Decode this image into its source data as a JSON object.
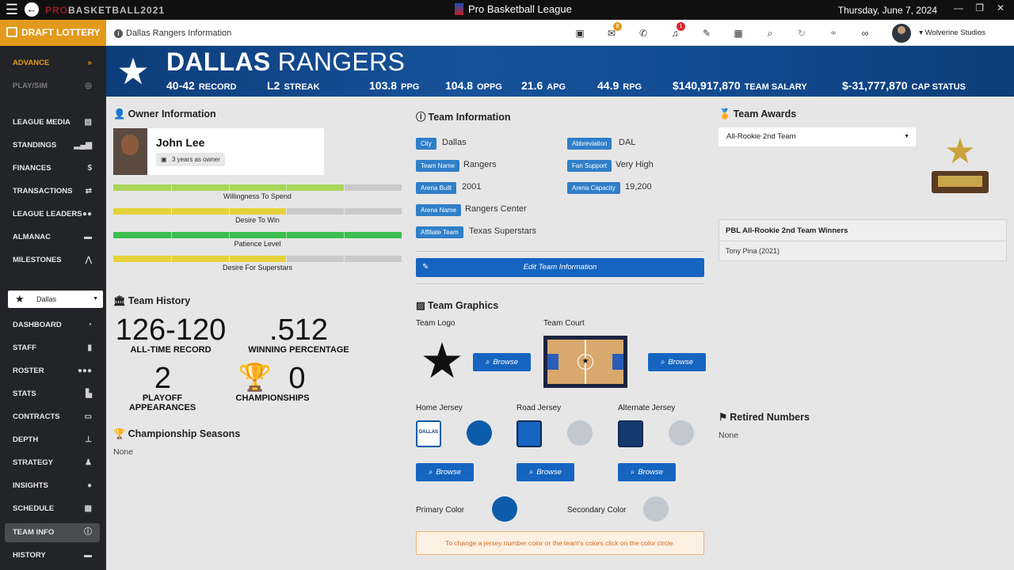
{
  "titlebar": {
    "brand_prefix": "PRO",
    "brand_suffix": "BASKETBALL2021",
    "league": "Pro Basketball League",
    "date": "Thursday, June 7, 2024"
  },
  "sidebar": {
    "draft_lottery": "DRAFT LOTTERY",
    "top_items": [
      {
        "label": "ADVANCE",
        "icon": "fast-forward-icon"
      },
      {
        "label": "PLAY/SIM",
        "icon": "basketball-icon"
      }
    ],
    "league_items": [
      {
        "label": "LEAGUE MEDIA",
        "icon": "newspaper-icon"
      },
      {
        "label": "STANDINGS",
        "icon": "bar-chart-icon"
      },
      {
        "label": "FINANCES",
        "icon": "dollar-icon"
      },
      {
        "label": "TRANSACTIONS",
        "icon": "exchange-icon"
      },
      {
        "label": "LEAGUE LEADERS",
        "icon": "users-icon"
      },
      {
        "label": "ALMANAC",
        "icon": "archive-icon"
      },
      {
        "label": "MILESTONES",
        "icon": "road-icon"
      }
    ],
    "team_select": "Dallas",
    "team_items": [
      {
        "label": "DASHBOARD",
        "icon": "gauge-icon"
      },
      {
        "label": "STAFF",
        "icon": "clipboard-icon"
      },
      {
        "label": "ROSTER",
        "icon": "people-icon"
      },
      {
        "label": "STATS",
        "icon": "chart-icon"
      },
      {
        "label": "CONTRACTS",
        "icon": "money-icon"
      },
      {
        "label": "DEPTH",
        "icon": "sitemap-icon"
      },
      {
        "label": "STRATEGY",
        "icon": "strategy-icon"
      },
      {
        "label": "INSIGHTS",
        "icon": "lightbulb-icon"
      },
      {
        "label": "SCHEDULE",
        "icon": "calendar-icon"
      },
      {
        "label": "TEAM INFO",
        "icon": "info-icon"
      },
      {
        "label": "HISTORY",
        "icon": "archive-icon"
      }
    ]
  },
  "header": {
    "page_title": "Dallas Rangers Information",
    "mail_badge": "8",
    "alert_badge": "1",
    "user": "Wolverine Studios"
  },
  "banner": {
    "team_city": "DALLAS",
    "team_name": "RANGERS",
    "record_value": "40-42",
    "record_label": "RECORD",
    "streak_value": "L2",
    "streak_label": "STREAK",
    "ppg_value": "103.8",
    "ppg_label": "PPG",
    "oppg_value": "104.8",
    "oppg_label": "OPPG",
    "apg_value": "21.6",
    "apg_label": "APG",
    "rpg_value": "44.9",
    "rpg_label": "RPG",
    "salary_value": "$140,917,870",
    "salary_label": "TEAM SALARY",
    "cap_value": "$-31,777,870",
    "cap_label": "CAP STATUS"
  },
  "owner": {
    "heading": "Owner Information",
    "name": "John Lee",
    "years": "3 years as owner",
    "bars": [
      {
        "label": "Willingness To Spend",
        "level": 0.8,
        "color": "#a8d65a"
      },
      {
        "label": "Desire To Win",
        "level": 0.6,
        "color": "#e6d23a"
      },
      {
        "label": "Patience Level",
        "level": 1.0,
        "color": "#3bbf4f"
      },
      {
        "label": "Desire For Superstars",
        "level": 0.6,
        "color": "#e6d23a"
      }
    ]
  },
  "history": {
    "heading": "Team History",
    "alltime_value": "126-120",
    "alltime_label": "ALL-TIME RECORD",
    "winpct_value": ".512",
    "winpct_label": "WINNING PERCENTAGE",
    "playoff_value": "2",
    "playoff_label": "PLAYOFF APPEARANCES",
    "champ_value": "0",
    "champ_label": "CHAMPIONSHIPS",
    "seasons_heading": "Championship Seasons",
    "seasons_value": "None"
  },
  "team_info": {
    "heading": "Team Information",
    "city_k": "City",
    "city_v": "Dallas",
    "abbr_k": "Abbreviation",
    "abbr_v": "DAL",
    "name_k": "Team Name",
    "name_v": "Rangers",
    "fan_k": "Fan Support",
    "fan_v": "Very High",
    "built_k": "Arena Built",
    "built_v": "2001",
    "cap_k": "Arena Capacity",
    "cap_v": "19,200",
    "arena_k": "Arena Name",
    "arena_v": "Rangers Center",
    "aff_k": "Affiliate Team",
    "aff_v": "Texas Superstars",
    "edit_label": "Edit Team Information"
  },
  "graphics": {
    "heading": "Team Graphics",
    "logo_label": "Team Logo",
    "court_label": "Team Court",
    "home_label": "Home Jersey",
    "road_label": "Road Jersey",
    "alt_label": "Alternate Jersey",
    "home_jersey_text": "DALLAS",
    "browse_label": "Browse",
    "primary_label": "Primary Color",
    "secondary_label": "Secondary Color",
    "primary_color": "#0d5cab",
    "secondary_color": "#c2c8d0",
    "tip": "To change a jersey number color or the team's colors click on the color circle."
  },
  "awards": {
    "heading": "Team Awards",
    "selected": "All-Rookie 2nd Team",
    "winners_heading": "PBL All-Rookie 2nd Team Winners",
    "winner": "Tony Pina (2021)",
    "retired_heading": "Retired Numbers",
    "retired_value": "None"
  }
}
